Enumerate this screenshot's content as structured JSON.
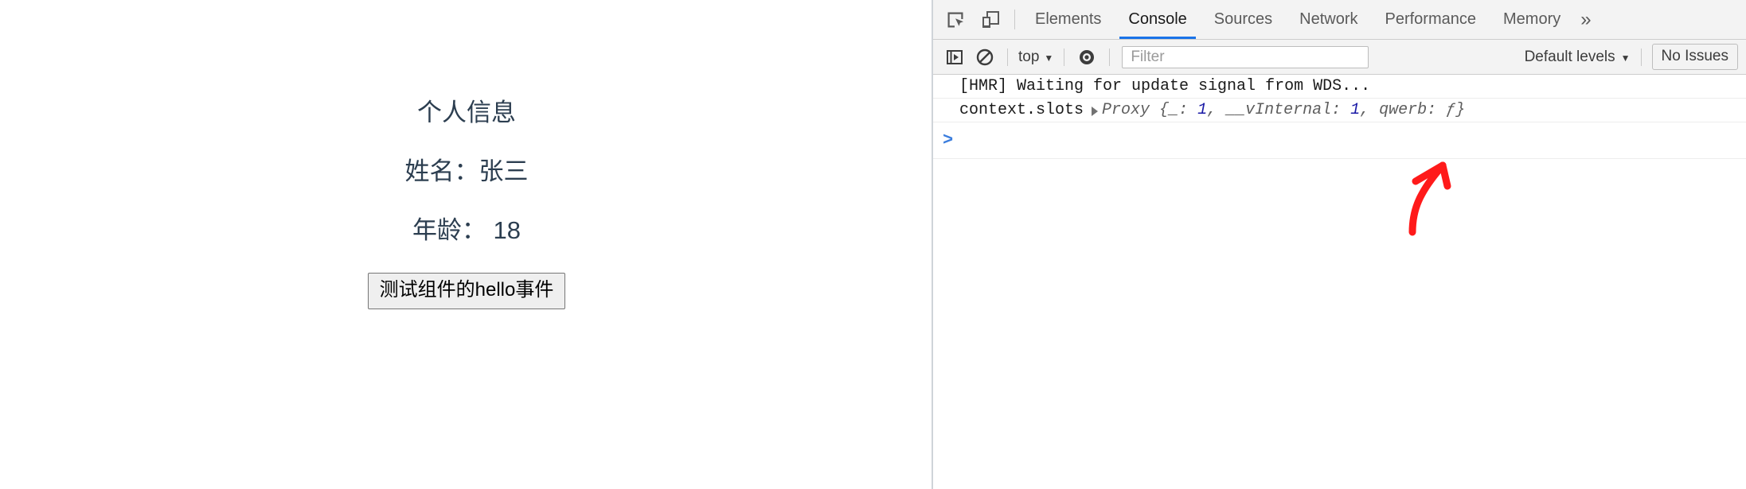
{
  "page": {
    "title": "个人信息",
    "fields": [
      {
        "label": "姓名：",
        "value": "张三",
        "full": "姓名：张三"
      },
      {
        "label": "年龄：",
        "value": "18",
        "full": "年龄： 18"
      }
    ],
    "button_label": "测试组件的hello事件"
  },
  "devtools": {
    "icons": {
      "inspect": "inspect-element-icon",
      "device": "device-toolbar-icon",
      "execute": "execute-step-icon",
      "clear": "clear-console-icon",
      "eye": "live-expression-eye-icon"
    },
    "tabs": [
      {
        "label": "Elements",
        "active": false
      },
      {
        "label": "Console",
        "active": true
      },
      {
        "label": "Sources",
        "active": false
      },
      {
        "label": "Network",
        "active": false
      },
      {
        "label": "Performance",
        "active": false
      },
      {
        "label": "Memory",
        "active": false
      }
    ],
    "more_tabs": "»",
    "toolbar": {
      "context_label": "top",
      "context_caret": "▼",
      "filter_placeholder": "Filter",
      "filter_value": "",
      "levels_label": "Default levels",
      "levels_caret": "▼",
      "issues_label": "No Issues"
    },
    "console": {
      "messages": [
        {
          "type": "log",
          "text": "[HMR] Waiting for update signal from WDS..."
        },
        {
          "type": "object",
          "label": "context.slots",
          "expander": "▶",
          "ctor": "Proxy ",
          "open_brace": "{",
          "entries": [
            {
              "key": "_: ",
              "value": "1",
              "sep": ", "
            },
            {
              "key": "__vInternal: ",
              "value": "1",
              "sep": ", "
            },
            {
              "key": "qwerb: ",
              "value": "ƒ",
              "sep": ""
            }
          ],
          "close_brace": "}"
        }
      ],
      "prompt": ">"
    }
  },
  "annotation": {
    "type": "arrow",
    "color": "#ff1a1a",
    "points_to": "qwerb"
  }
}
